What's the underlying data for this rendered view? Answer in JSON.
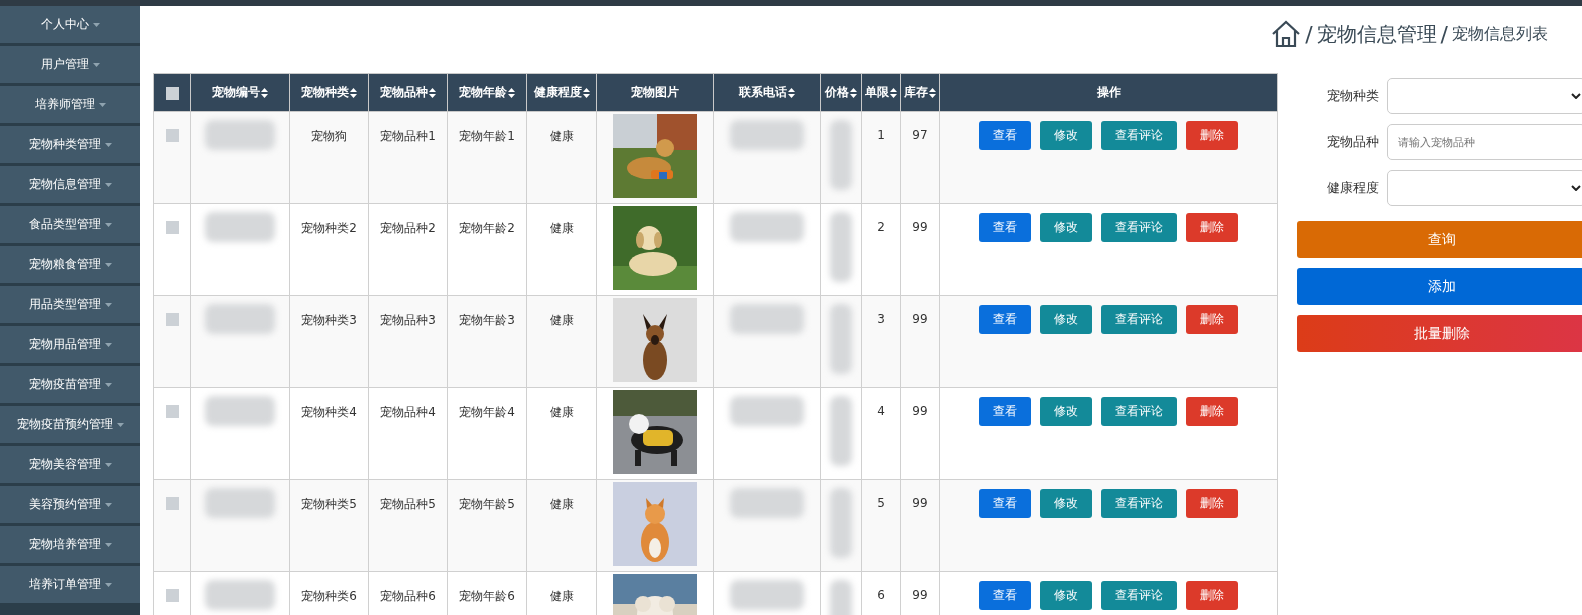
{
  "sidebar": {
    "items": [
      {
        "label": "个人中心"
      },
      {
        "label": "用户管理"
      },
      {
        "label": "培养师管理"
      },
      {
        "label": "宠物种类管理"
      },
      {
        "label": "宠物信息管理"
      },
      {
        "label": "食品类型管理"
      },
      {
        "label": "宠物粮食管理"
      },
      {
        "label": "用品类型管理"
      },
      {
        "label": "宠物用品管理"
      },
      {
        "label": "宠物疫苗管理"
      },
      {
        "label": "宠物疫苗预约管理"
      },
      {
        "label": "宠物美容管理"
      },
      {
        "label": "美容预约管理"
      },
      {
        "label": "宠物培养管理"
      },
      {
        "label": "培养订单管理"
      }
    ]
  },
  "breadcrumb": {
    "items": [
      {
        "label": "/",
        "kind": "separator"
      },
      {
        "label": "宠物信息管理",
        "kind": "section"
      },
      {
        "label": "/",
        "kind": "separator"
      },
      {
        "label": "宠物信息列表",
        "kind": "page"
      }
    ]
  },
  "table": {
    "select_all": {
      "checked": false
    },
    "columns": [
      {
        "label": "宠物编号",
        "sortable": true
      },
      {
        "label": "宠物种类",
        "sortable": true
      },
      {
        "label": "宠物品种",
        "sortable": true
      },
      {
        "label": "宠物年龄",
        "sortable": true
      },
      {
        "label": "健康程度",
        "sortable": true
      },
      {
        "label": "宠物图片",
        "sortable": false
      },
      {
        "label": "联系电话",
        "sortable": true
      },
      {
        "label": "价格",
        "sortable": true
      },
      {
        "label": "单限",
        "sortable": true
      },
      {
        "label": "库存",
        "sortable": true
      },
      {
        "label": "操作",
        "sortable": false
      }
    ],
    "rows": [
      {
        "checked": false,
        "type": "宠物狗",
        "breed": "宠物品种1",
        "age": "宠物年龄1",
        "health": "健康",
        "limit": "1",
        "stock": "97",
        "actions": [
          {
            "label": "查看",
            "kind": "primary"
          },
          {
            "label": "修改",
            "kind": "info"
          },
          {
            "label": "查看评论",
            "kind": "info"
          },
          {
            "label": "删除",
            "kind": "danger"
          }
        ]
      },
      {
        "checked": false,
        "type": "宠物种类2",
        "breed": "宠物品种2",
        "age": "宠物年龄2",
        "health": "健康",
        "limit": "2",
        "stock": "99",
        "actions": [
          {
            "label": "查看",
            "kind": "primary"
          },
          {
            "label": "修改",
            "kind": "info"
          },
          {
            "label": "查看评论",
            "kind": "info"
          },
          {
            "label": "删除",
            "kind": "danger"
          }
        ]
      },
      {
        "checked": false,
        "type": "宠物种类3",
        "breed": "宠物品种3",
        "age": "宠物年龄3",
        "health": "健康",
        "limit": "3",
        "stock": "99",
        "actions": [
          {
            "label": "查看",
            "kind": "primary"
          },
          {
            "label": "修改",
            "kind": "info"
          },
          {
            "label": "查看评论",
            "kind": "info"
          },
          {
            "label": "删除",
            "kind": "danger"
          }
        ]
      },
      {
        "checked": false,
        "type": "宠物种类4",
        "breed": "宠物品种4",
        "age": "宠物年龄4",
        "health": "健康",
        "limit": "4",
        "stock": "99",
        "actions": [
          {
            "label": "查看",
            "kind": "primary"
          },
          {
            "label": "修改",
            "kind": "info"
          },
          {
            "label": "查看评论",
            "kind": "info"
          },
          {
            "label": "删除",
            "kind": "danger"
          }
        ]
      },
      {
        "checked": false,
        "type": "宠物种类5",
        "breed": "宠物品种5",
        "age": "宠物年龄5",
        "health": "健康",
        "limit": "5",
        "stock": "99",
        "actions": [
          {
            "label": "查看",
            "kind": "primary"
          },
          {
            "label": "修改",
            "kind": "info"
          },
          {
            "label": "查看评论",
            "kind": "info"
          },
          {
            "label": "删除",
            "kind": "danger"
          }
        ]
      },
      {
        "checked": false,
        "type": "宠物种类6",
        "breed": "宠物品种6",
        "age": "宠物年龄6",
        "health": "健康",
        "limit": "6",
        "stock": "99",
        "actions": [
          {
            "label": "查看",
            "kind": "primary"
          },
          {
            "label": "修改",
            "kind": "info"
          },
          {
            "label": "查看评论",
            "kind": "info"
          },
          {
            "label": "删除",
            "kind": "danger"
          }
        ]
      }
    ]
  },
  "search": {
    "fields": [
      {
        "label": "宠物种类",
        "kind": "select"
      },
      {
        "label": "宠物品种",
        "kind": "text",
        "placeholder": "请输入宠物品种"
      },
      {
        "label": "健康程度",
        "kind": "select"
      }
    ],
    "buttons": [
      {
        "label": "查询",
        "kind": "search"
      },
      {
        "label": "添加",
        "kind": "add"
      },
      {
        "label": "批量删除",
        "kind": "delete"
      }
    ]
  }
}
